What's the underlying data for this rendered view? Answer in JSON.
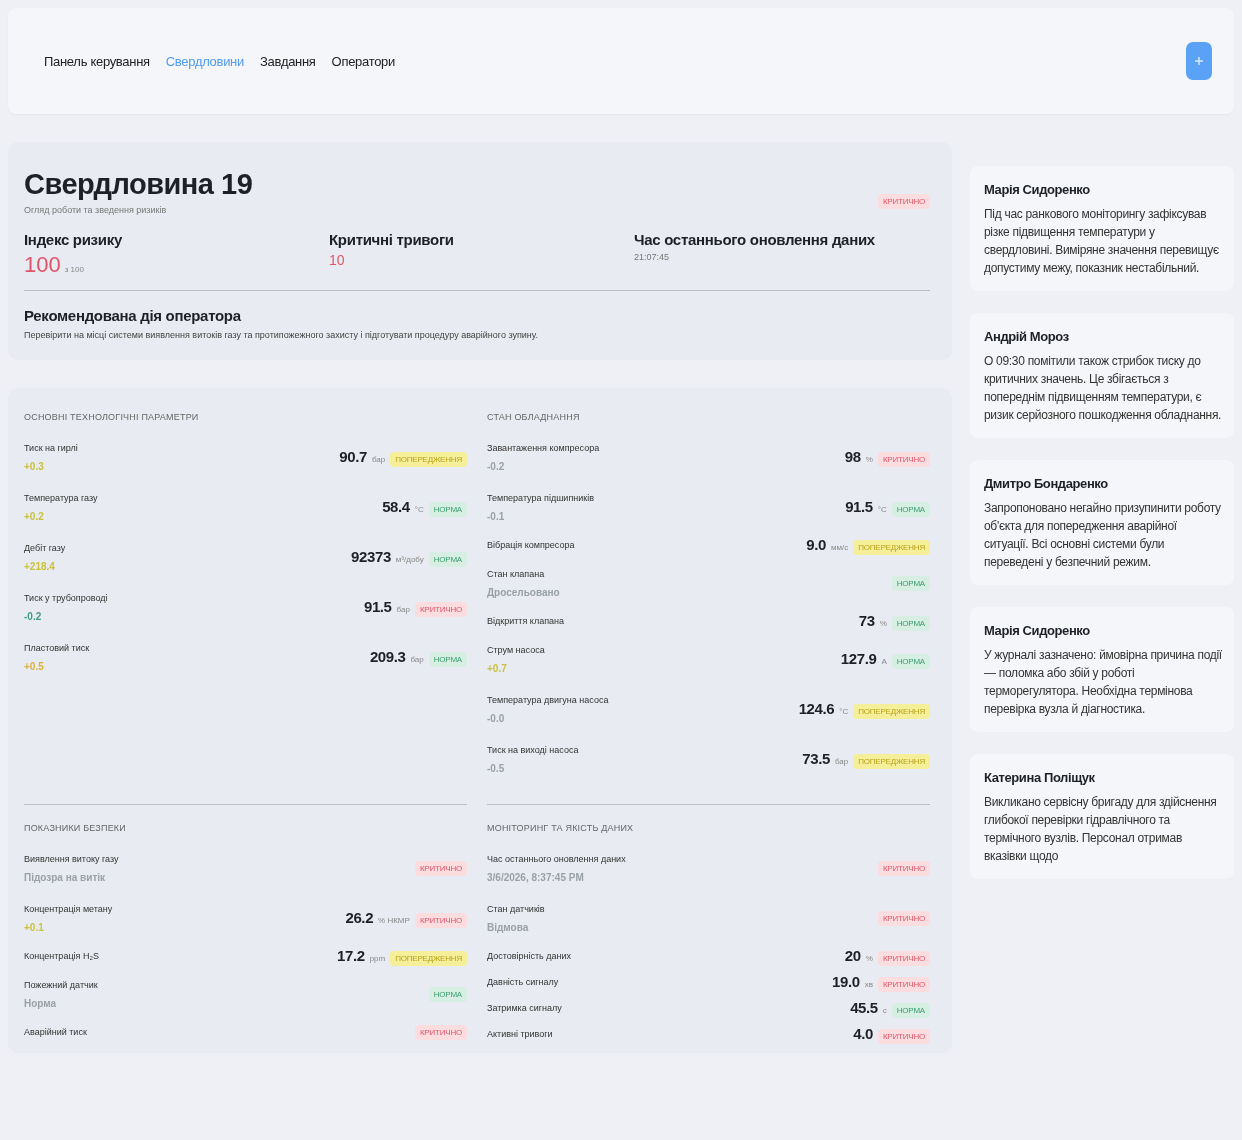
{
  "nav": {
    "tabs": [
      {
        "label": "Панель керування",
        "selected": false
      },
      {
        "label": "Свердловини",
        "selected": true
      },
      {
        "label": "Завдання",
        "selected": false
      },
      {
        "label": "Оператори",
        "selected": false
      }
    ]
  },
  "well": {
    "title": "Свердловина 19",
    "subtitle": "Огляд роботи та зведення ризиків",
    "status": {
      "label": "КРИТИЧНО",
      "kind": "critical"
    },
    "metrics": [
      {
        "label": "Індекс ризику",
        "value": "100",
        "unit": "з 100",
        "kind": "risk"
      },
      {
        "label": "Критичні тривоги",
        "value": "10",
        "kind": "count"
      },
      {
        "label": "Час останнього оновлення даних",
        "value": "21:07:45",
        "kind": "time"
      }
    ],
    "recommendation": {
      "title": "Рекомендована дія оператора",
      "text": "Перевірити на місці системи виявлення витоків газу та протипожежного захисту і підготувати процедуру аварійного зупину."
    }
  },
  "sections": [
    {
      "title": "ОСНОВНІ ТЕХНОЛОГІЧНІ ПАРАМЕТРИ",
      "rows": [
        {
          "label": "Тиск на гирлі",
          "sub": "+0.3",
          "color": "#c9c23a",
          "value": "90.7",
          "unit": "бар",
          "kind": "warning",
          "badge": "ПОПЕРЕДЖЕННЯ"
        },
        {
          "label": "Температура газу",
          "sub": "+0.2",
          "color": "#c9c23a",
          "value": "58.4",
          "unit": "°C",
          "kind": "normal",
          "badge": "НОРМА"
        },
        {
          "label": "Дебіт газу",
          "sub": "+218.4",
          "color": "#c9c23a",
          "value": "92373",
          "unit": "м³/добу",
          "kind": "normal",
          "badge": "НОРМА"
        },
        {
          "label": "Тиск у трубопроводі",
          "sub": "-0.2",
          "color": "#3e9b8a",
          "value": "91.5",
          "unit": "бар",
          "kind": "critical",
          "badge": "КРИТИЧНО"
        },
        {
          "label": "Пластовий тиск",
          "sub": "+0.5",
          "color": "#d9b23a",
          "value": "209.3",
          "unit": "бар",
          "kind": "normal",
          "badge": "НОРМА"
        }
      ]
    },
    {
      "title": "СТАН ОБЛАДНАННЯ",
      "rows": [
        {
          "label": "Завантаження компресора",
          "sub": "-0.2",
          "color": "#9aa0a8",
          "value": "98",
          "unit": "%",
          "kind": "critical",
          "badge": "КРИТИЧНО"
        },
        {
          "label": "Температура підшипників",
          "sub": "-0.1",
          "color": "#9aa0a8",
          "value": "91.5",
          "unit": "°C",
          "kind": "normal",
          "badge": "НОРМА"
        },
        {
          "label": "Вібрація компресора",
          "value": "9.0",
          "unit": "мм/с",
          "kind": "warning",
          "badge": "ПОПЕРЕДЖЕННЯ"
        },
        {
          "label": "Стан клапана",
          "sub": "Дросельовано",
          "color": "#9aa0a8",
          "kind": "normal",
          "badge": "НОРМА"
        },
        {
          "label": "Відкриття клапана",
          "value": "73",
          "unit": "%",
          "kind": "normal",
          "badge": "НОРМА"
        },
        {
          "label": "Струм насоса",
          "sub": "+0.7",
          "color": "#c9c23a",
          "value": "127.9",
          "unit": "А",
          "kind": "normal",
          "badge": "НОРМА"
        },
        {
          "label": "Температура двигуна насоса",
          "sub": "-0.0",
          "color": "#9aa0a8",
          "value": "124.6",
          "unit": "°C",
          "kind": "warning",
          "badge": "ПОПЕРЕДЖЕННЯ"
        },
        {
          "label": "Тиск на виході насоса",
          "sub": "-0.5",
          "color": "#9aa0a8",
          "value": "73.5",
          "unit": "бар",
          "kind": "warning",
          "badge": "ПОПЕРЕДЖЕННЯ"
        }
      ]
    },
    {
      "title": "ПОКАЗНИКИ БЕЗПЕКИ",
      "rows": [
        {
          "label": "Виявлення витоку газу",
          "sub": "Підозра на витік",
          "color": "#9aa0a8",
          "kind": "critical",
          "badge": "КРИТИЧНО"
        },
        {
          "label": "Концентрація метану",
          "sub": "+0.1",
          "color": "#c9c23a",
          "value": "26.2",
          "unit": "% НКМР",
          "kind": "critical",
          "badge": "КРИТИЧНО"
        },
        {
          "label": "Концентрація H₂S",
          "value": "17.2",
          "unit": "ppm",
          "kind": "warning",
          "badge": "ПОПЕРЕДЖЕННЯ"
        },
        {
          "label": "Пожежний датчик",
          "sub": "Норма",
          "color": "#9aa0a8",
          "kind": "normal",
          "badge": "НОРМА"
        },
        {
          "label": "Аварійний тиск",
          "kind": "critical",
          "badge": "КРИТИЧНО"
        }
      ]
    },
    {
      "title": "МОНІТОРИНГ ТА ЯКІСТЬ ДАНИХ",
      "rows": [
        {
          "label": "Час останнього оновлення даних",
          "sub": "3/6/2026, 8:37:45 PM",
          "color": "#9aa0a8",
          "kind": "critical",
          "badge": "КРИТИЧНО"
        },
        {
          "label": "Стан датчиків",
          "sub": "Відмова",
          "color": "#9aa0a8",
          "kind": "critical",
          "badge": "КРИТИЧНО"
        },
        {
          "label": "Достовірність даних",
          "value": "20",
          "unit": "%",
          "kind": "critical",
          "badge": "КРИТИЧНО"
        },
        {
          "label": "Давність сигналу",
          "value": "19.0",
          "unit": "хв",
          "kind": "critical",
          "badge": "КРИТИЧНО"
        },
        {
          "label": "Затримка сигналу",
          "value": "45.5",
          "unit": "с",
          "kind": "normal",
          "badge": "НОРМА"
        },
        {
          "label": "Активні тривоги",
          "value": "4.0",
          "kind": "critical",
          "badge": "КРИТИЧНО"
        }
      ]
    }
  ],
  "comments": [
    {
      "author": "Марія Сидоренко",
      "text": "Під час ранкового моніторингу зафіксував різке підвищення температури у свердловині. Виміряне значення перевищує допустиму межу, показник нестабільний."
    },
    {
      "author": "Андрій Мороз",
      "text": "О 09:30 помітили також стрибок тиску до критичних значень. Це збігається з попереднім підвищенням температури, є ризик серйозного пошкодження обладнання."
    },
    {
      "author": "Дмитро Бондаренко",
      "text": "Запропоновано негайно призупинити роботу об'єкта для попередження аварійної ситуації. Всі основні системи були переведені у безпечний режим."
    },
    {
      "author": "Марія Сидоренко",
      "text": "У журналі зазначено: ймовірна причина події — поломка або збій у роботі терморегулятора. Необхідна термінова перевірка вузла й діагностика."
    },
    {
      "author": "Катерина Поліщук",
      "text": "Викликано сервісну бригаду для здійснення глибокої перевірки гідравлічного та термічного вузлів. Персонал отримав вказівки щодо"
    }
  ]
}
